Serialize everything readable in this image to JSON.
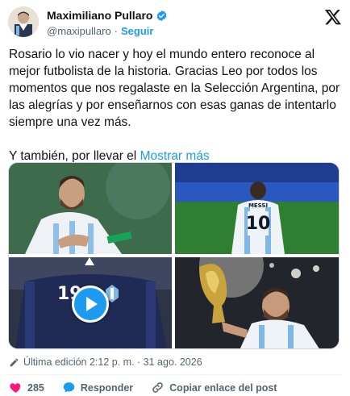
{
  "author": {
    "name": "Maximiliano Pullaro",
    "handle": "@maxipullaro",
    "separator": "·",
    "follow_label": "Seguir"
  },
  "tweet": {
    "paragraph1": "Rosario lo vio nacer y hoy el mundo entero reconoce al mejor futbolista de la historia. Gracias Leo por todos los momentos que nos regalaste en la Selección Argentina, por las alegrías y por enseñarnos con esas ganas de intentarlo siempre una vez más.",
    "paragraph2_prefix": "Y también, por llevar el",
    "show_more": "Mostrar más"
  },
  "media": {
    "photo3_jersey": "19"
  },
  "meta": {
    "edited_label": "Última edición 2:12 p. m. · 31 ago. 2026"
  },
  "actions": {
    "likes": "285",
    "reply_label": "Responder",
    "copy_label": "Copiar enlace del post"
  },
  "colors": {
    "accent": "#1d9bf0",
    "like": "#f91880",
    "text": "#0f1419",
    "muted": "#536471"
  }
}
